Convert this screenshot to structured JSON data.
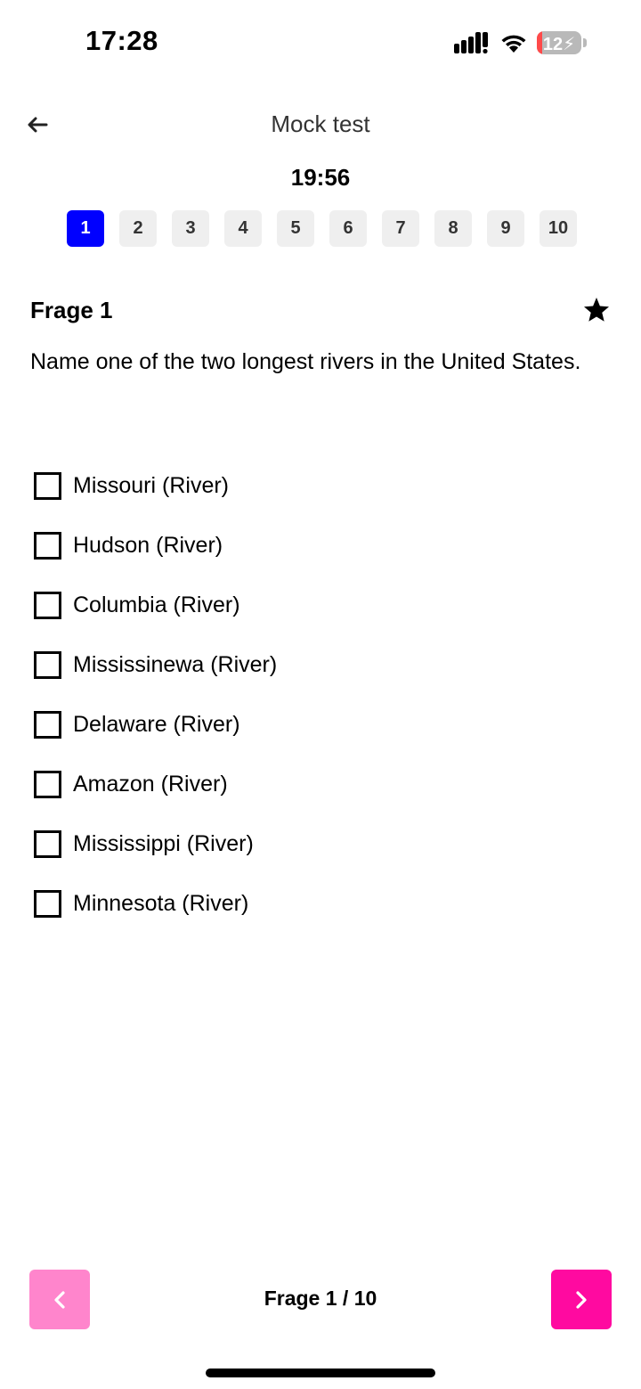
{
  "status_bar": {
    "time": "17:28",
    "battery_level": "12",
    "battery_fill_fraction": 0.12,
    "battery_color": "#ff4a4a"
  },
  "header": {
    "title": "Mock test",
    "back_icon": "arrow-left-icon",
    "timer": "19:56"
  },
  "question_nav": {
    "items": [
      "1",
      "2",
      "3",
      "4",
      "5",
      "6",
      "7",
      "8",
      "9",
      "10"
    ],
    "active_index": 0,
    "active_color": "#0000ff"
  },
  "question": {
    "label": "Frage 1",
    "text": "Name one of the two longest rivers in the United States.",
    "favorite_icon": "star-icon",
    "options": [
      "Missouri (River)",
      "Hudson (River)",
      "Columbia (River)",
      "Mississinewa (River)",
      "Delaware (River)",
      "Amazon (River)",
      "Mississippi (River)",
      "Minnesota (River)"
    ]
  },
  "footer": {
    "page_indicator": "Frage 1 / 10",
    "prev_icon": "chevron-left-icon",
    "next_icon": "chevron-right-icon",
    "prev_color": "#ff85cc",
    "next_color": "#ff0aa0"
  }
}
